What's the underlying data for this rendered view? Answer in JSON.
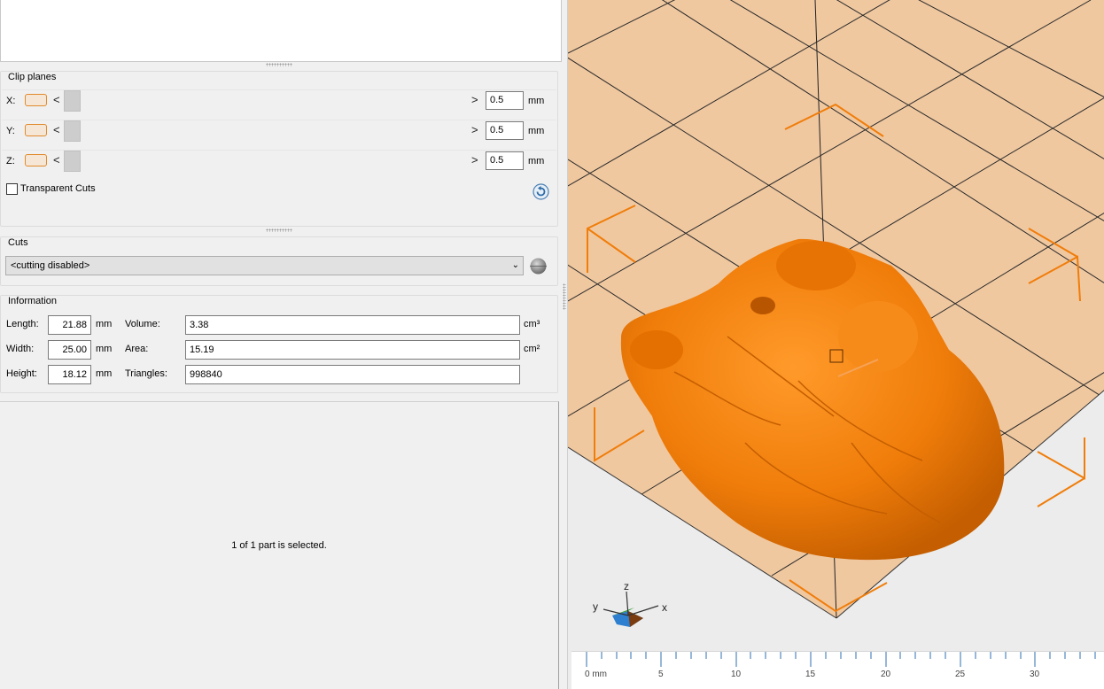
{
  "clip_planes": {
    "title": "Clip planes",
    "rows": [
      {
        "axis": "X:",
        "value": "0.5",
        "unit": "mm"
      },
      {
        "axis": "Y:",
        "value": "0.5",
        "unit": "mm"
      },
      {
        "axis": "Z:",
        "value": "0.5",
        "unit": "mm"
      }
    ],
    "left_arrow": "<",
    "right_arrow": ">",
    "transparent_cuts": "Transparent Cuts"
  },
  "cuts": {
    "title": "Cuts",
    "select_value": "<cutting disabled>"
  },
  "information": {
    "title": "Information",
    "length_label": "Length:",
    "length": "21.88",
    "width_label": "Width:",
    "width": "25.00",
    "height_label": "Height:",
    "height": "18.12",
    "mm": "mm",
    "volume_label": "Volume:",
    "volume": "3.38",
    "volume_unit": "cm³",
    "area_label": "Area:",
    "area": "15.19",
    "area_unit": "cm²",
    "triangles_label": "Triangles:",
    "triangles": "998840"
  },
  "status": "1 of 1 part is selected.",
  "axes": {
    "x": "x",
    "y": "y",
    "z": "z"
  },
  "ruler": {
    "labels": [
      "0 mm",
      "5",
      "10",
      "15",
      "20",
      "25",
      "30"
    ]
  },
  "colors": {
    "model": "#f07d0a",
    "bed": "#f0c8a0",
    "accent": "#e08a2c"
  }
}
